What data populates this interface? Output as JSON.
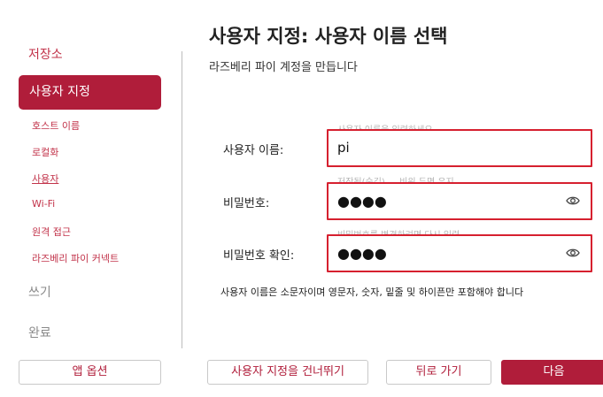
{
  "sidebar": {
    "storage": "저장소",
    "customize": "사용자 지정",
    "sub_items": [
      "호스트 이름",
      "로컬화",
      "사용자",
      "Wi-Fi",
      "원격 접근",
      "라즈베리 파이 커넥트"
    ],
    "write": "쓰기",
    "done": "완료",
    "app_options": "앱 옵션"
  },
  "main": {
    "title": "사용자 지정: 사용자 이름 선택",
    "subtitle": "라즈베리 파이 계정을 만듭니다",
    "username": {
      "label": "사용자 이름:",
      "hint": "사용자 이름을 입력하세요",
      "value": "pi"
    },
    "password": {
      "label": "비밀번호:",
      "hint": "저장됨(숨김) — 비워 두면 유지",
      "value": "●●●●"
    },
    "confirm": {
      "label": "비밀번호 확인:",
      "hint": "비밀번호를 변경하려면 다시 입력...",
      "value": "●●●●"
    },
    "note": "사용자 이름은 소문자이며 영문자, 숫자, 밑줄 및 하이픈만 포함해야 합니다"
  },
  "buttons": {
    "skip": "사용자 지정을 건너뛰기",
    "back": "뒤로 가기",
    "next": "다음"
  },
  "colors": {
    "accent": "#b01d3a",
    "highlight": "#d6202f"
  }
}
